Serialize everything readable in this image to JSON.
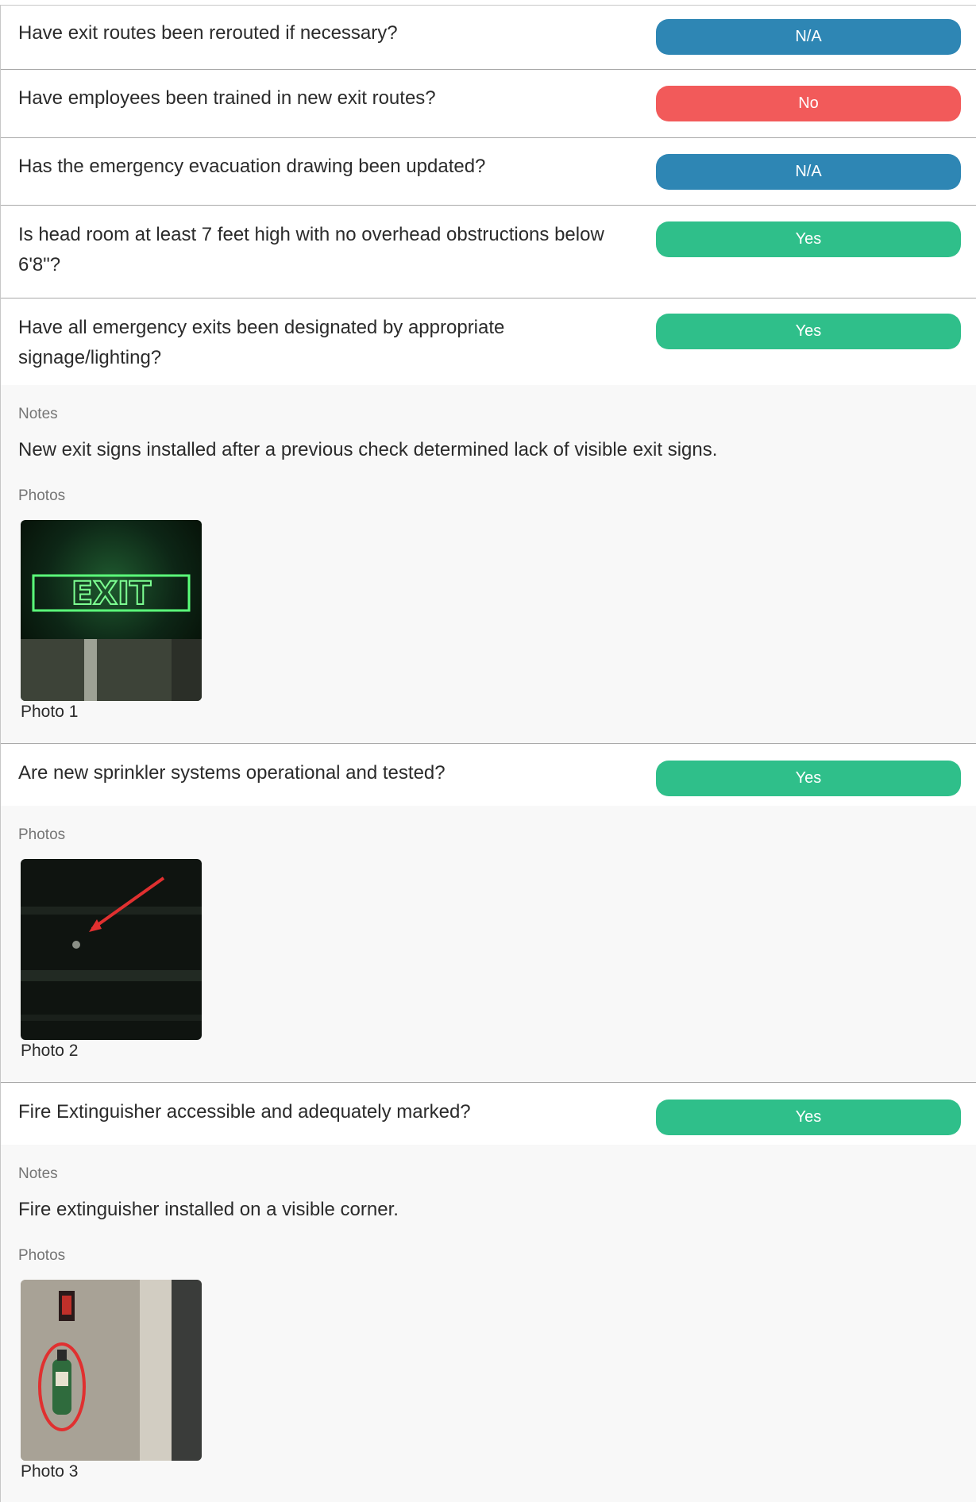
{
  "colors": {
    "na": "#2E86B4",
    "no": "#F25A5A",
    "yes": "#2FBF8A"
  },
  "items": [
    {
      "question": "Have exit routes been rerouted if necessary?",
      "answer": "N/A",
      "status": "na"
    },
    {
      "question": "Have employees been trained in new exit routes?",
      "answer": "No",
      "status": "no"
    },
    {
      "question": "Has the emergency evacuation drawing been updated?",
      "answer": "N/A",
      "status": "na"
    },
    {
      "question": "Is head room at least 7 feet high with no overhead obstructions below 6'8\"?",
      "answer": "Yes",
      "status": "yes"
    },
    {
      "question": "Have all emergency exits been designated by appropriate signage/lighting?",
      "answer": "Yes",
      "status": "yes",
      "notes_label": "Notes",
      "note": "New exit signs installed after a previous check determined lack of visible exit signs.",
      "photos_label": "Photos",
      "photo_icon": "exit-sign-photo",
      "photo_caption": "Photo 1"
    },
    {
      "question": "Are new sprinkler systems operational and tested?",
      "answer": "Yes",
      "status": "yes",
      "photos_label": "Photos",
      "photo_icon": "sprinkler-photo",
      "photo_caption": "Photo 2"
    },
    {
      "question": "Fire Extinguisher accessible and adequately marked?",
      "answer": "Yes",
      "status": "yes",
      "notes_label": "Notes",
      "note": "Fire extinguisher installed on a visible corner.",
      "photos_label": "Photos",
      "photo_icon": "fire-extinguisher-photo",
      "photo_caption": "Photo 3"
    }
  ]
}
